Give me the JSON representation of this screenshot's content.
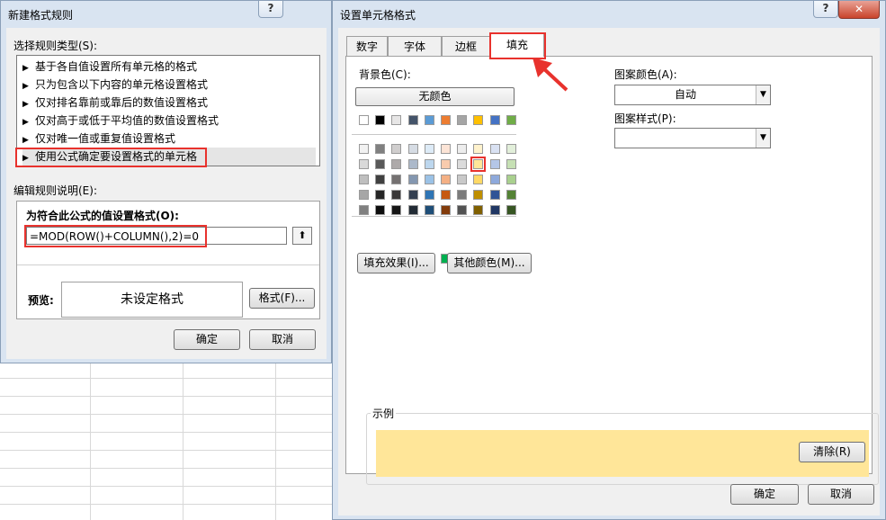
{
  "dialog1": {
    "title": "新建格式规则",
    "help": "?",
    "rule_type_label": "选择规则类型(S):",
    "rule_types": [
      "基于各自值设置所有单元格的格式",
      "只为包含以下内容的单元格设置格式",
      "仅对排名靠前或靠后的数值设置格式",
      "仅对高于或低于平均值的数值设置格式",
      "仅对唯一值或重复值设置格式",
      "使用公式确定要设置格式的单元格"
    ],
    "arrow_glyph": "▶",
    "edit_desc_label": "编辑规则说明(E):",
    "formula_label": "为符合此公式的值设置格式(O):",
    "formula_value": "=MOD(ROW()+COLUMN(),2)=0",
    "collapse_glyph": "⬆",
    "preview_label": "预览:",
    "preview_text": "未设定格式",
    "format_button": "格式(F)...",
    "ok": "确定",
    "cancel": "取消"
  },
  "dialog2": {
    "title": "设置单元格格式",
    "help": "?",
    "close": "✕",
    "tabs": [
      "数字",
      "字体",
      "边框",
      "填充"
    ],
    "active_tab": "填充",
    "bg_color_label": "背景色(C):",
    "no_color": "无颜色",
    "fill_effects": "填充效果(I)...",
    "more_colors": "其他颜色(M)...",
    "pattern_color_label": "图案颜色(A):",
    "pattern_color_value": "自动",
    "pattern_style_label": "图案样式(P):",
    "pattern_style_value": "",
    "sample_label": "示例",
    "clear": "清除(R)",
    "ok": "确定",
    "cancel": "取消",
    "sample_color": "#FFE699",
    "theme_top_row": [
      "#FFFFFF",
      "#000000",
      "#E7E6E6",
      "#44546A",
      "#5B9BD5",
      "#ED7D31",
      "#A5A5A5",
      "#FFC000",
      "#4472C4",
      "#70AD47"
    ],
    "theme_shades": [
      [
        "#F2F2F2",
        "#808080",
        "#D0CECE",
        "#D6DCE4",
        "#DDEBF7",
        "#FCE4D6",
        "#EDEDED",
        "#FFF2CC",
        "#D9E1F2",
        "#E2EFDA"
      ],
      [
        "#D9D9D9",
        "#595959",
        "#AEAAAA",
        "#ACB9CA",
        "#BDD7EE",
        "#F8CBAD",
        "#DBDBDB",
        "#FFE699",
        "#B4C6E7",
        "#C6E0B4"
      ],
      [
        "#BFBFBF",
        "#404040",
        "#757171",
        "#8497B0",
        "#9BC2E6",
        "#F4B084",
        "#C9C9C9",
        "#FFD966",
        "#8EA9DB",
        "#A9D08E"
      ],
      [
        "#A6A6A6",
        "#262626",
        "#3A3838",
        "#333F4F",
        "#2F75B5",
        "#C65911",
        "#7B7B7B",
        "#BF8F00",
        "#305496",
        "#548235"
      ],
      [
        "#808080",
        "#0D0D0D",
        "#161616",
        "#222B35",
        "#1F4E78",
        "#833C0C",
        "#525252",
        "#806000",
        "#203764",
        "#375623"
      ]
    ],
    "standard_colors": [
      "#C00000",
      "#FF0000",
      "#FFC000",
      "#FFFF00",
      "#92D050",
      "#00B050",
      "#00B0F0",
      "#0070C0",
      "#002060",
      "#7030A0"
    ],
    "annotation_color": "#E8322D"
  }
}
